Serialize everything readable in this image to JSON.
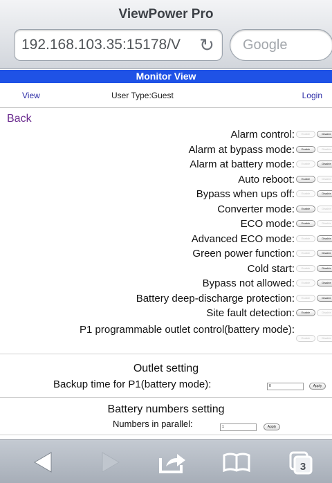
{
  "browser": {
    "title": "ViewPower Pro",
    "url": "192.168.103.35:15178/V",
    "search_placeholder": "Google",
    "tabs_count": "3"
  },
  "header": {
    "title": "Monitor View",
    "nav_view": "View",
    "user_type": "User Type:Guest",
    "nav_login": "Login",
    "back": "Back"
  },
  "buttons": {
    "enable": "Enable",
    "disable": "Disable",
    "apply": "Apply"
  },
  "settings": [
    {
      "label": "Alarm control:",
      "state": "disabled"
    },
    {
      "label": "Alarm at bypass mode:",
      "state": "enabled"
    },
    {
      "label": "Alarm at battery mode:",
      "state": "disabled"
    },
    {
      "label": "Auto reboot:",
      "state": "enabled"
    },
    {
      "label": "Bypass when ups off:",
      "state": "disabled"
    },
    {
      "label": "Converter mode:",
      "state": "enabled"
    },
    {
      "label": "ECO mode:",
      "state": "enabled"
    },
    {
      "label": "Advanced ECO mode:",
      "state": "disabled"
    },
    {
      "label": "Green power function:",
      "state": "disabled"
    },
    {
      "label": "Cold start:",
      "state": "disabled"
    },
    {
      "label": "Bypass not allowed:",
      "state": "disabled"
    },
    {
      "label": "Battery deep-discharge protection:",
      "state": "disabled"
    },
    {
      "label": "Site fault detection:",
      "state": "enabled"
    },
    {
      "label": "P1 programmable outlet control(battery mode):",
      "state": "none"
    }
  ],
  "outlet": {
    "title": "Outlet setting",
    "label": "Backup time for P1(battery mode):",
    "value": "0"
  },
  "battery": {
    "title": "Battery numbers setting",
    "label": "Numbers in parallel:",
    "value": "1"
  }
}
